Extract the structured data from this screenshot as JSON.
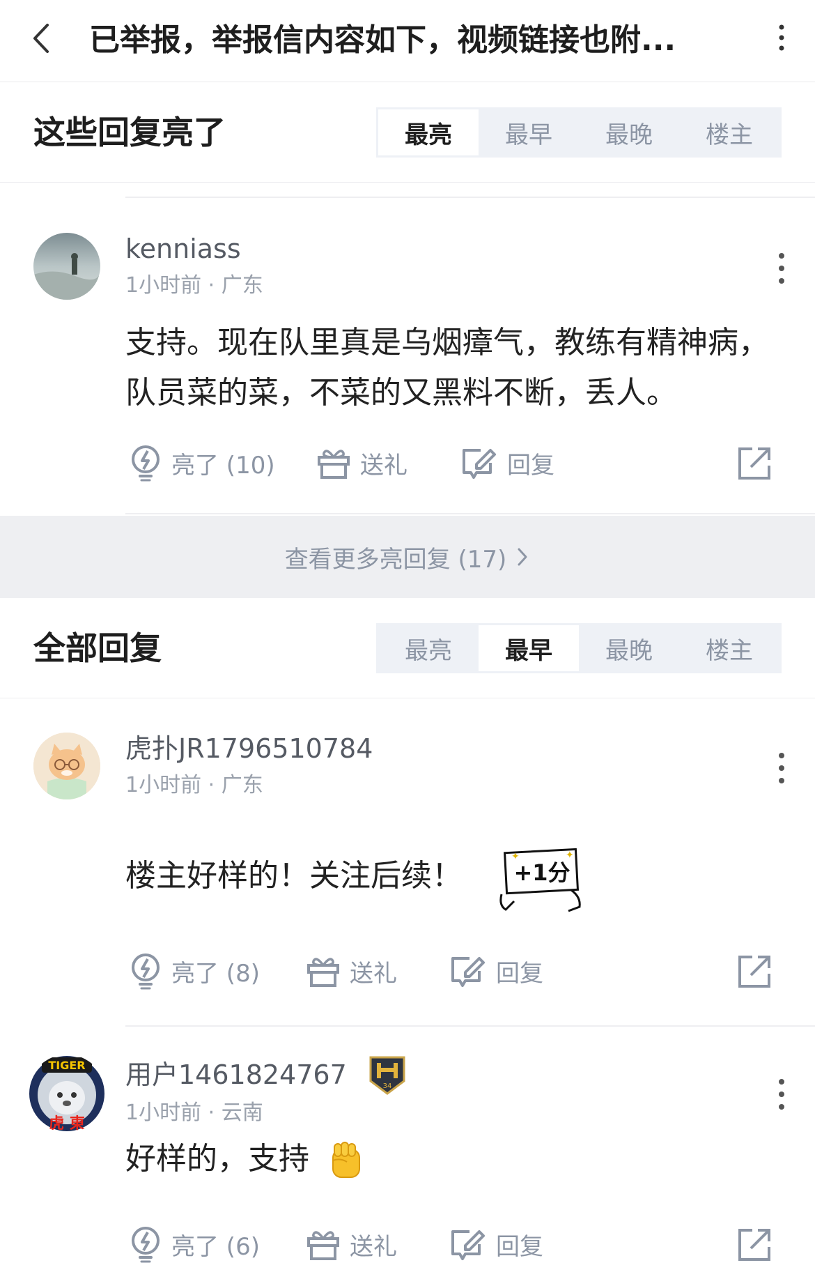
{
  "header": {
    "title": "已举报，举报信内容如下，视频链接也附..."
  },
  "bright_section": {
    "title": "这些回复亮了",
    "tabs": [
      "最亮",
      "最早",
      "最晚",
      "楼主"
    ],
    "active_tab": "最亮"
  },
  "bright_comments": [
    {
      "username": "kenniass",
      "meta": "1小时前 · 广东",
      "text": "支持。现在队里真是乌烟瘴气，教练有精神病，队员菜的菜，不菜的又黑料不断，丢人。",
      "light_label": "亮了 (10)",
      "gift_label": "送礼",
      "reply_label": "回复"
    }
  ],
  "more_bright": {
    "label": "查看更多亮回复 (17)"
  },
  "all_section": {
    "title": "全部回复",
    "tabs": [
      "最亮",
      "最早",
      "最晚",
      "楼主"
    ],
    "active_tab": "最早"
  },
  "all_comments": [
    {
      "username": "虎扑JR1796510784",
      "meta": "1小时前 · 广东",
      "text": "楼主好样的！关注后续！",
      "light_label": "亮了 (8)",
      "gift_label": "送礼",
      "reply_label": "回复",
      "sticker_text": "+1分"
    },
    {
      "username": "用户1461824767",
      "meta": "1小时前 · 云南",
      "text": "好样的，支持",
      "light_label": "亮了 (6)",
      "gift_label": "送礼",
      "reply_label": "回复",
      "badge_number": "34",
      "avatar_text": "TIGER",
      "avatar_chars": "虎  東"
    }
  ],
  "colors": {
    "accent_gray": "#8c95a4",
    "segment_bg": "#eef1f6",
    "more_bar_bg": "#eeeff2",
    "text_dark": "#1e1e1e"
  }
}
